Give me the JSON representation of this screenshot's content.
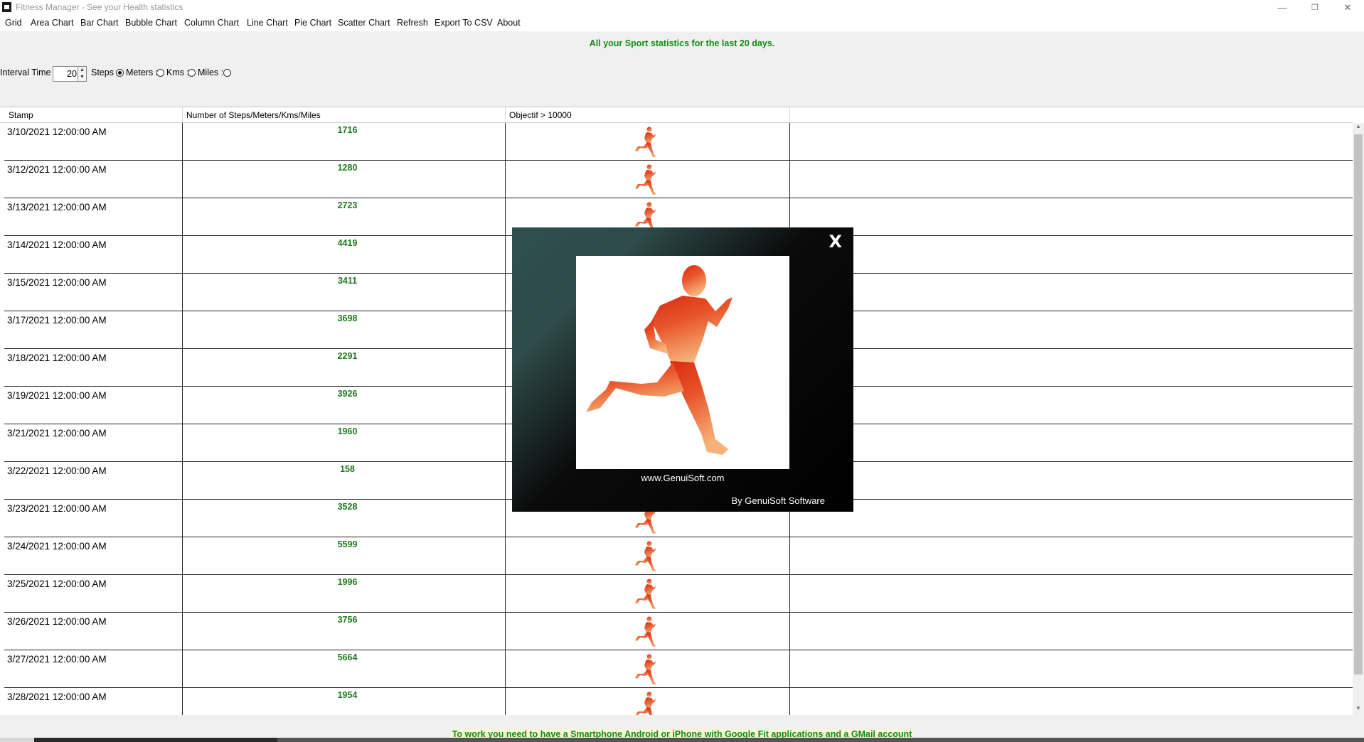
{
  "window": {
    "title": "Fitness Manager - See your Health statistics",
    "minimize": "—",
    "restore": "❐",
    "close": "✕"
  },
  "menu": [
    "Grid",
    "Area Chart",
    "Bar Chart",
    "Bubble Chart",
    "Column Chart",
    "Line Chart",
    "Pie Chart",
    "Scatter Chart",
    "Refresh",
    "Export To CSV",
    "About"
  ],
  "header_message": "All your Sport statistics for the last 20 days.",
  "controls": {
    "interval_label": "Interval Time :",
    "interval_value": "20",
    "steps_label": "Steps :",
    "meters_label": "Meters :",
    "kms_label": "Kms :",
    "miles_label": "Miles :",
    "selected_unit": "steps"
  },
  "grid": {
    "columns": [
      "Stamp",
      "Number of Steps/Meters/Kms/Miles",
      "Objectif > 10000"
    ],
    "rows": [
      {
        "stamp": "3/10/2021 12:00:00 AM",
        "value": "1716"
      },
      {
        "stamp": "3/12/2021 12:00:00 AM",
        "value": "1280"
      },
      {
        "stamp": "3/13/2021 12:00:00 AM",
        "value": "2723"
      },
      {
        "stamp": "3/14/2021 12:00:00 AM",
        "value": "4419"
      },
      {
        "stamp": "3/15/2021 12:00:00 AM",
        "value": "3411"
      },
      {
        "stamp": "3/17/2021 12:00:00 AM",
        "value": "3698"
      },
      {
        "stamp": "3/18/2021 12:00:00 AM",
        "value": "2291"
      },
      {
        "stamp": "3/19/2021 12:00:00 AM",
        "value": "3926"
      },
      {
        "stamp": "3/21/2021 12:00:00 AM",
        "value": "1960"
      },
      {
        "stamp": "3/22/2021 12:00:00 AM",
        "value": "158"
      },
      {
        "stamp": "3/23/2021 12:00:00 AM",
        "value": "3528"
      },
      {
        "stamp": "3/24/2021 12:00:00 AM",
        "value": "5599"
      },
      {
        "stamp": "3/25/2021 12:00:00 AM",
        "value": "1996"
      },
      {
        "stamp": "3/26/2021 12:00:00 AM",
        "value": "3756"
      },
      {
        "stamp": "3/27/2021 12:00:00 AM",
        "value": "5664"
      },
      {
        "stamp": "3/28/2021 12:00:00 AM",
        "value": "1954"
      }
    ]
  },
  "splash": {
    "close_label": "X",
    "url": "www.GenuiSoft.com",
    "by": "By GenuiSoft Software"
  },
  "footer_message": "To work you need to have a Smartphone Android or iPhone with Google Fit applications and a GMail account",
  "colors": {
    "accent_green": "#138a13",
    "runner_red": "#e0421b",
    "runner_orange": "#f0925a"
  }
}
